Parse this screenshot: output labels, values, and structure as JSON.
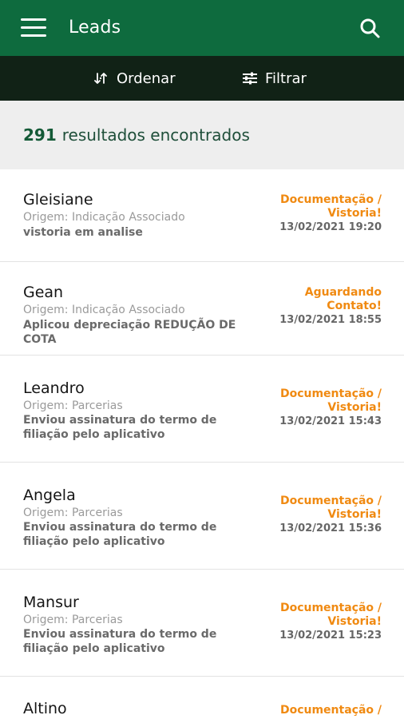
{
  "appbar": {
    "title": "Leads"
  },
  "toolbar": {
    "order_label": "Ordenar",
    "filter_label": "Filtrar"
  },
  "summary": {
    "count": "291",
    "text": "resultados encontrados"
  },
  "leads": [
    {
      "name": "Gleisiane",
      "origin": "Origem: Indicação Associado",
      "note": "vistoria em analise",
      "status_line1": "Documentação /",
      "status_line2": "Vistoria!",
      "date": "13/02/2021 19:20"
    },
    {
      "name": "Gean",
      "origin": "Origem: Indicação Associado",
      "note": "Aplicou depreciação REDUÇÃO DE COTA",
      "status_line1": "Aguardando",
      "status_line2": "Contato!",
      "date": "13/02/2021 18:55"
    },
    {
      "name": "Leandro",
      "origin": "Origem: Parcerias",
      "note": "Enviou assinatura do termo de filiação pelo aplicativo",
      "status_line1": "Documentação /",
      "status_line2": "Vistoria!",
      "date": "13/02/2021 15:43"
    },
    {
      "name": "Angela",
      "origin": "Origem: Parcerias",
      "note": "Enviou assinatura do termo de filiação pelo aplicativo",
      "status_line1": "Documentação /",
      "status_line2": "Vistoria!",
      "date": "13/02/2021 15:36"
    },
    {
      "name": "Mansur",
      "origin": "Origem: Parcerias",
      "note": "Enviou assinatura do termo de filiação pelo aplicativo",
      "status_line1": "Documentação /",
      "status_line2": "Vistoria!",
      "date": "13/02/2021 15:23"
    },
    {
      "name": "Altino",
      "origin": "",
      "note": "",
      "status_line1": "Documentação /",
      "status_line2": "",
      "date": ""
    }
  ],
  "colors": {
    "appbar": "#0e6b3e",
    "toolbar": "#112216",
    "status": "#f08a12",
    "count": "#145a37"
  },
  "icons": {
    "menu": "hamburger-menu-icon",
    "search": "search-icon",
    "order": "sort-arrows-icon",
    "filter": "filter-sliders-icon"
  }
}
